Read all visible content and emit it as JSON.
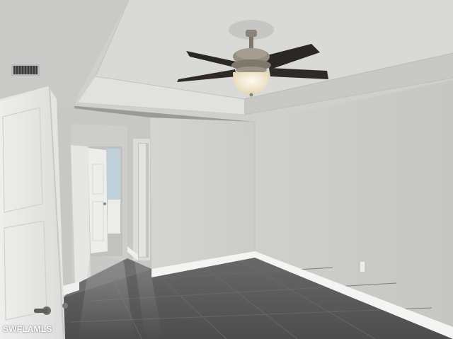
{
  "watermark": {
    "text": "SWFLAMLS"
  },
  "icons": {
    "ceiling_fan": "ceiling-fan-icon",
    "light_fixture": "light-globe-icon",
    "air_vent": "air-vent-icon",
    "door_lever": "door-handle-icon",
    "wall_outlet": "outlet-icon"
  },
  "colors": {
    "wall": "#d3d3d1",
    "wall_shadow": "#bdbdbb",
    "ceiling": "#dcdcda",
    "trim": "#f2f2f0",
    "floor": "#5b5b5b",
    "door": "#e9e9e7",
    "fan_blade": "#2b2726",
    "fan_metal": "#8b8478",
    "globe": "#f3e8cf"
  }
}
